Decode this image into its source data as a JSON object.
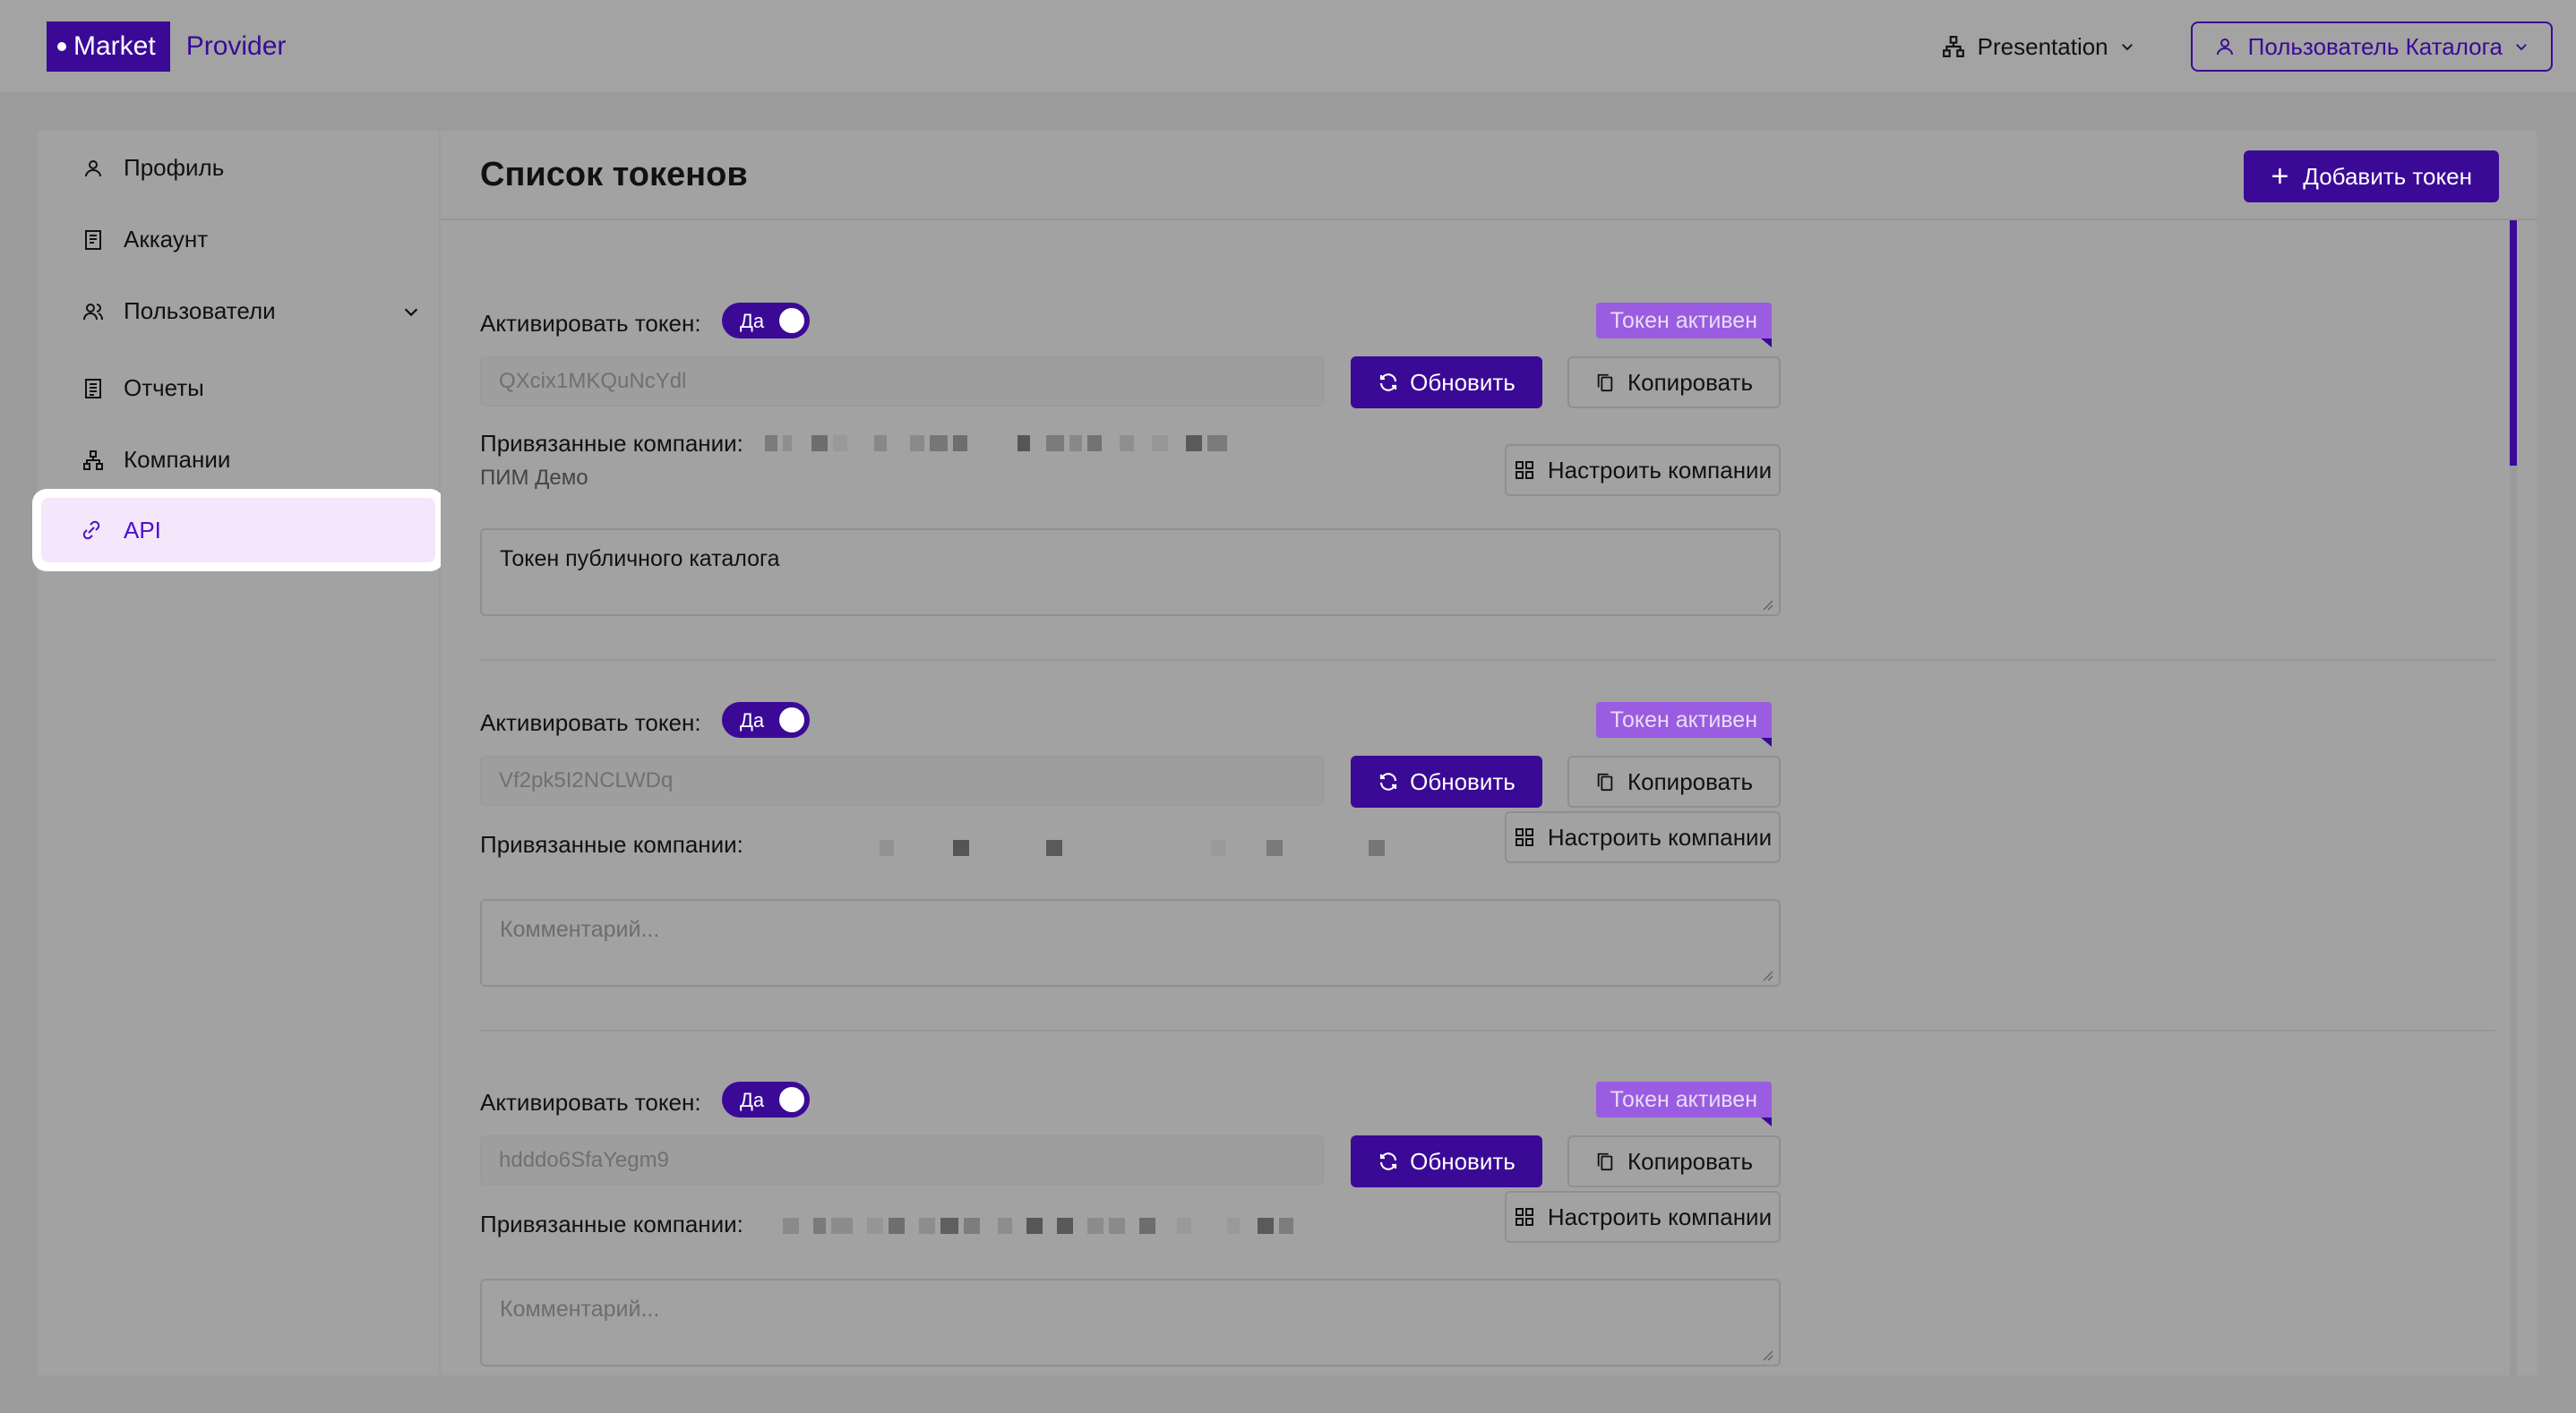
{
  "header": {
    "logo_main": "Market",
    "logo_secondary": "Provider",
    "workspace": "Presentation",
    "user": "Пользователь Каталога"
  },
  "sidebar": {
    "items": [
      {
        "label": "Профиль",
        "icon": "user-icon"
      },
      {
        "label": "Аккаунт",
        "icon": "account-icon"
      },
      {
        "label": "Пользователи",
        "icon": "users-icon",
        "expandable": true
      },
      {
        "label": "Отчеты",
        "icon": "report-icon"
      },
      {
        "label": "Компании",
        "icon": "companies-icon"
      },
      {
        "label": "API",
        "icon": "api-icon",
        "active": true
      }
    ]
  },
  "main": {
    "title": "Список токенов",
    "add_button": "Добавить токен",
    "tokens": [
      {
        "activate_label": "Активировать токен:",
        "toggle_label": "Да",
        "status": "Токен активен",
        "token_value": "QXcix1MKQuNcYdl",
        "refresh_label": "Обновить",
        "copy_label": "Копировать",
        "companies_label": "Привязанные компании:",
        "companies_extra": "ПИМ Демо",
        "configure_label": "Настроить компании",
        "comment": "Токен публичного каталога"
      },
      {
        "activate_label": "Активировать токен:",
        "toggle_label": "Да",
        "status": "Токен активен",
        "token_value": "Vf2pk5I2NCLWDq",
        "refresh_label": "Обновить",
        "copy_label": "Копировать",
        "companies_label": "Привязанные компании:",
        "configure_label": "Настроить компании",
        "comment_placeholder": "Комментарий..."
      },
      {
        "activate_label": "Активировать токен:",
        "toggle_label": "Да",
        "status": "Токен активен",
        "token_value": "hdddo6SfaYegm9",
        "refresh_label": "Обновить",
        "copy_label": "Копировать",
        "companies_label": "Привязанные компании:",
        "configure_label": "Настроить компании",
        "comment_placeholder": "Комментарий..."
      }
    ]
  },
  "colors": {
    "brand": "#3a0a96",
    "active_nav_bg": "#f4e6fb",
    "badge": "#9a5ce0"
  }
}
